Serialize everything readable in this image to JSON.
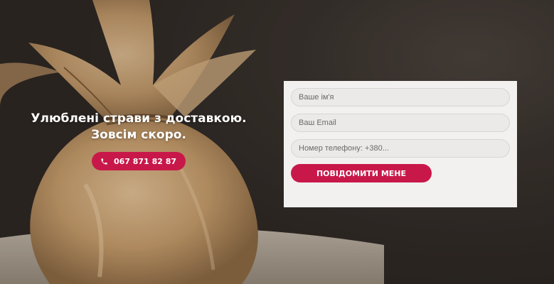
{
  "hero": {
    "headline": "Улюблені страви з доставкою. Зовсім скоро.",
    "phone_label": "067 871 82 87",
    "phone_icon": "phone-icon"
  },
  "form": {
    "name_placeholder": "Ваше ім'я",
    "email_placeholder": "Ваш Email",
    "phone_placeholder": "Номер телефону: +380...",
    "submit_label": "ПОВІДОМИТИ МЕНЕ"
  },
  "colors": {
    "accent": "#c8184a",
    "form_background": "#f2f1ef",
    "page_background": "#3a332e"
  }
}
